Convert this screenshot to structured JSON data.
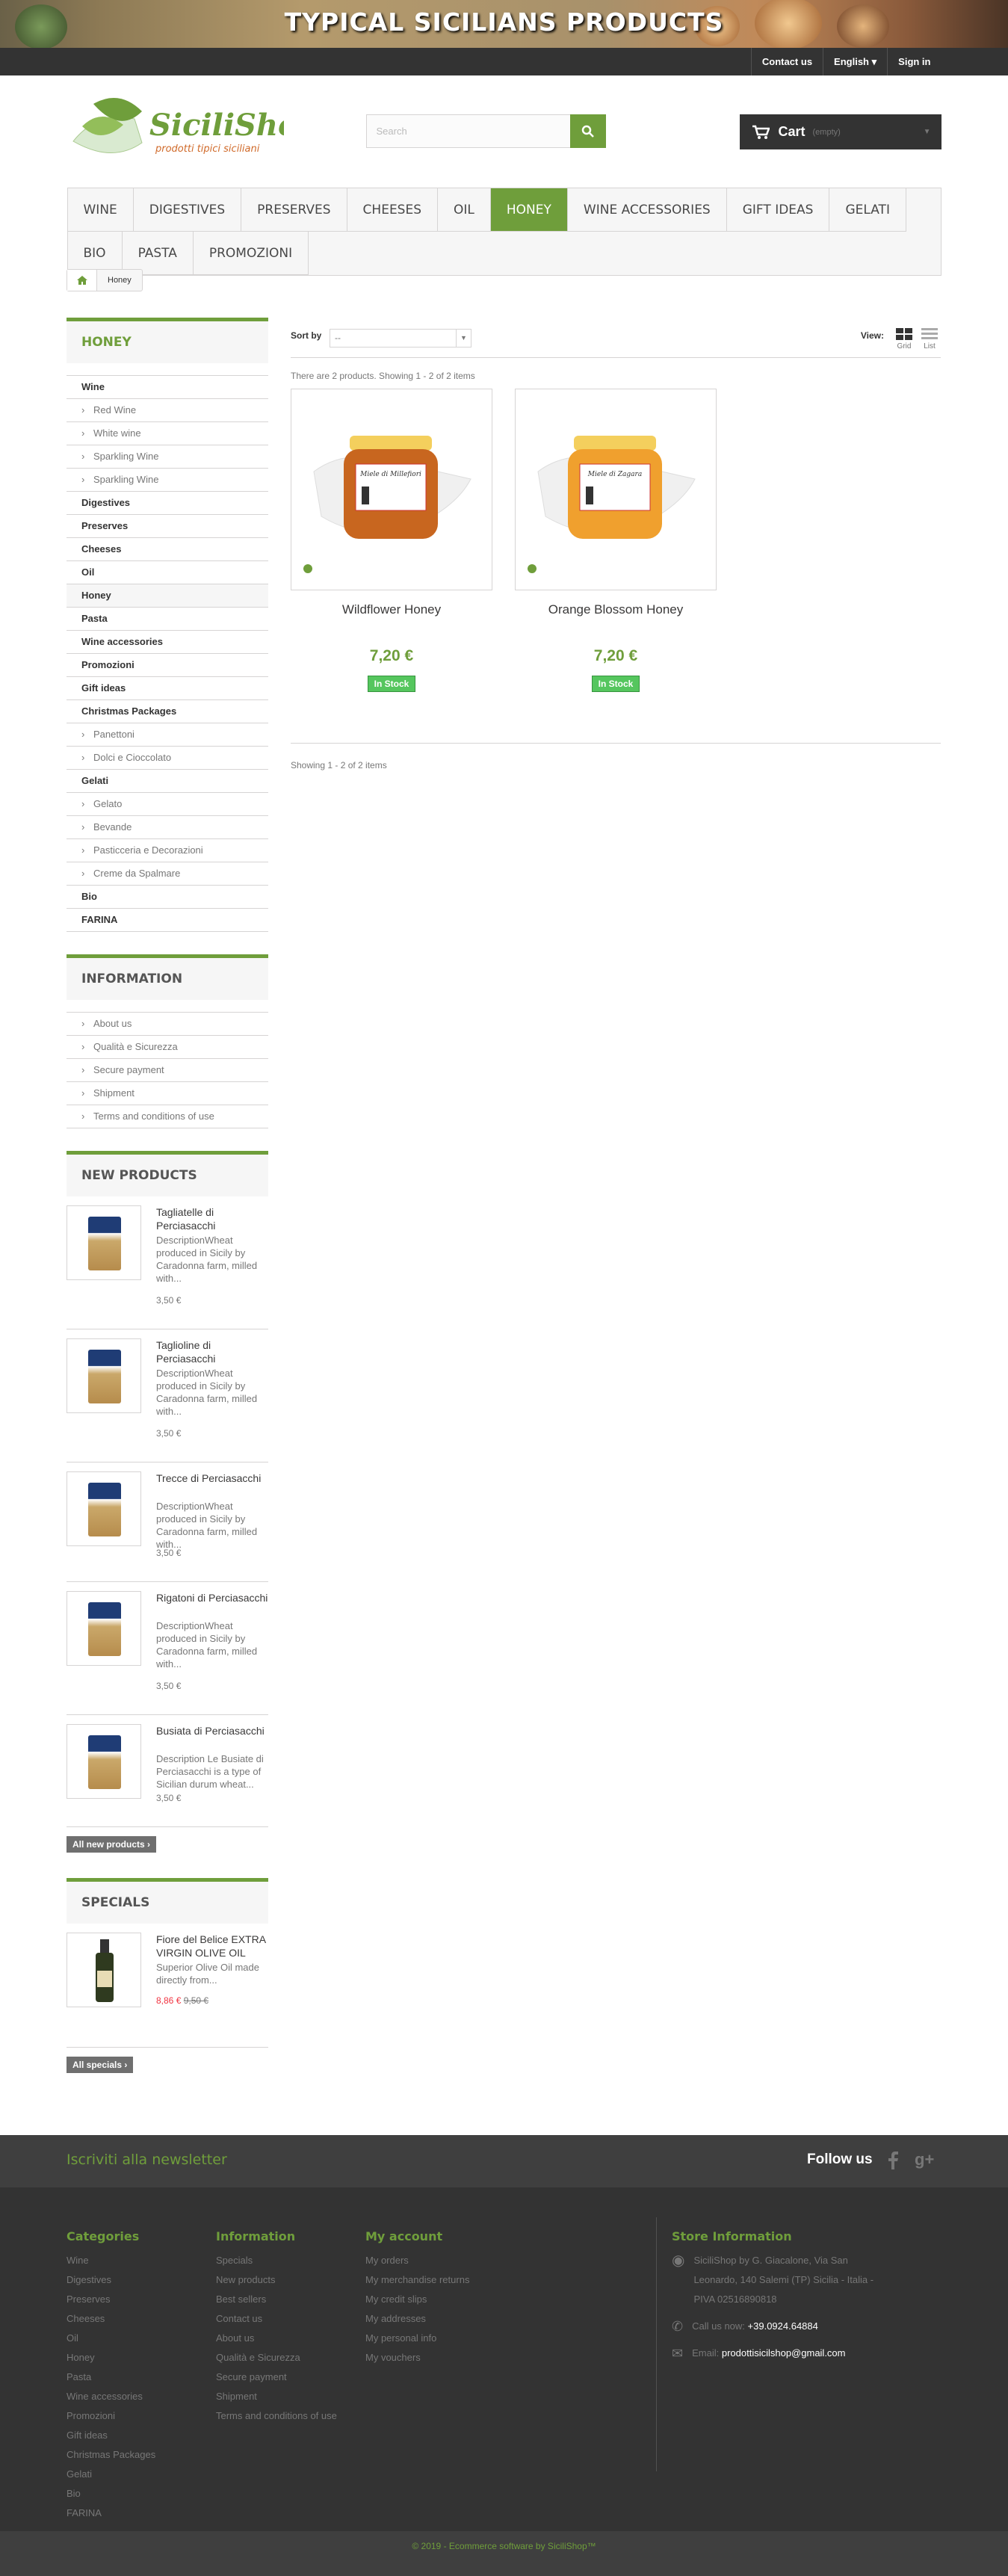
{
  "banner": {
    "title": "TYPICAL SICILIANS PRODUCTS"
  },
  "topbar": {
    "contact": "Contact us",
    "language": "English",
    "signin": "Sign in"
  },
  "logo": {
    "name": "SiciliShop",
    "tagline": "prodotti tipici siciliani"
  },
  "search": {
    "placeholder": "Search"
  },
  "cart": {
    "label": "Cart",
    "status": "(empty)"
  },
  "menu": [
    "WINE",
    "DIGESTIVES",
    "PRESERVES",
    "CHEESES",
    "OIL",
    "HONEY",
    "WINE ACCESSORIES",
    "GIFT IDEAS",
    "GELATI",
    "BIO",
    "PASTA",
    "PROMOZIONI"
  ],
  "breadcrumb": {
    "current": "Honey"
  },
  "categories": {
    "title": "HONEY",
    "items": [
      {
        "t": "Wine",
        "k": "c"
      },
      {
        "t": "Red Wine",
        "k": "s"
      },
      {
        "t": "White wine",
        "k": "s"
      },
      {
        "t": "Sparkling Wine",
        "k": "s"
      },
      {
        "t": "Sparkling Wine",
        "k": "s"
      },
      {
        "t": "Digestives",
        "k": "c"
      },
      {
        "t": "Preserves",
        "k": "c"
      },
      {
        "t": "Cheeses",
        "k": "c"
      },
      {
        "t": "Oil",
        "k": "c"
      },
      {
        "t": "Honey",
        "k": "c"
      },
      {
        "t": "Pasta",
        "k": "c"
      },
      {
        "t": "Wine accessories",
        "k": "c"
      },
      {
        "t": "Promozioni",
        "k": "c"
      },
      {
        "t": "Gift ideas",
        "k": "c"
      },
      {
        "t": "Christmas Packages",
        "k": "c"
      },
      {
        "t": "Panettoni",
        "k": "s"
      },
      {
        "t": "Dolci e Cioccolato",
        "k": "s"
      },
      {
        "t": "Gelati",
        "k": "c"
      },
      {
        "t": "Gelato",
        "k": "s"
      },
      {
        "t": "Bevande",
        "k": "s"
      },
      {
        "t": "Pasticceria e Decorazioni",
        "k": "s"
      },
      {
        "t": "Creme da Spalmare",
        "k": "s"
      },
      {
        "t": "Bio",
        "k": "c"
      },
      {
        "t": "FARINA",
        "k": "c"
      }
    ]
  },
  "information": {
    "title": "INFORMATION",
    "items": [
      "About us",
      "Qualità e Sicurezza",
      "Secure payment",
      "Shipment",
      "Terms and conditions of use"
    ]
  },
  "new_products": {
    "title": "NEW PRODUCTS",
    "items": [
      {
        "name": "Tagliatelle di Perciasacchi",
        "desc": "DescriptionWheat produced in Sicily by Caradonna farm, milled with...",
        "price": "3,50 €"
      },
      {
        "name": "Taglioline di Perciasacchi",
        "desc": "DescriptionWheat produced in Sicily by Caradonna farm, milled with...",
        "price": "3,50 €"
      },
      {
        "name": "Trecce di Perciasacchi",
        "desc": "DescriptionWheat produced in Sicily by Caradonna farm, milled with...",
        "price": "3,50 €"
      },
      {
        "name": "Rigatoni di Perciasacchi",
        "desc": "DescriptionWheat produced in Sicily by Caradonna farm, milled with...",
        "price": "3,50 €"
      },
      {
        "name": "Busiata di Perciasacchi",
        "desc": "Description Le Busiate di Perciasacchi is a type of Sicilian durum wheat...",
        "price": "3,50 €"
      }
    ],
    "all": "All new products"
  },
  "specials": {
    "title": "SPECIALS",
    "item": {
      "name": "Fiore del Belice EXTRA VIRGIN OLIVE OIL",
      "desc": "Superior Olive Oil made directly from...",
      "price": "8,86 €",
      "old": "9,50 €"
    },
    "all": "All specials"
  },
  "sort": {
    "label": "Sort by",
    "value": "--",
    "view": "View:",
    "grid": "Grid",
    "list": "List"
  },
  "count": "There are 2 products.   Showing 1 - 2 of 2 items",
  "products": [
    {
      "name": "Wildflower Honey",
      "price": "7,20 €",
      "stock": "In Stock",
      "label": "Miele di Millefiori",
      "color": "#c8661f"
    },
    {
      "name": "Orange Blossom Honey",
      "price": "7,20 €",
      "stock": "In Stock",
      "label": "Miele di Zagara",
      "color": "#f0a02e"
    }
  ],
  "showing": "Showing 1 - 2 of 2 items",
  "newsletter": {
    "title": "Iscriviti alla newsletter",
    "follow": "Follow us"
  },
  "footer": {
    "categories": {
      "title": "Categories",
      "items": [
        "Wine",
        "Digestives",
        "Preserves",
        "Cheeses",
        "Oil",
        "Honey",
        "Pasta",
        "Wine accessories",
        "Promozioni",
        "Gift ideas",
        "Christmas Packages",
        "Gelati",
        "Bio",
        "FARINA"
      ]
    },
    "information": {
      "title": "Information",
      "items": [
        "Specials",
        "New products",
        "Best sellers",
        "Contact us",
        "About us",
        "Qualità e Sicurezza",
        "Secure payment",
        "Shipment",
        "Terms and conditions of use"
      ]
    },
    "account": {
      "title": "My account",
      "items": [
        "My orders",
        "My merchandise returns",
        "My credit slips",
        "My addresses",
        "My personal info",
        "My vouchers"
      ]
    },
    "store": {
      "title": "Store Information",
      "address": "SiciliShop by G. Giacalone, Via San Leonardo, 140 Salemi (TP) Sicilia - Italia - PIVA 02516890818",
      "call": "Call us now:",
      "phone": "+39.0924.64884",
      "email_label": "Email:",
      "email": "prodottisicilshop@gmail.com"
    }
  },
  "copyright": "© 2019 - Ecommerce software by SiciliShop™",
  "colors": {
    "accent": "#6f9e3b",
    "dark": "#333333",
    "stock": "#55c65e"
  }
}
